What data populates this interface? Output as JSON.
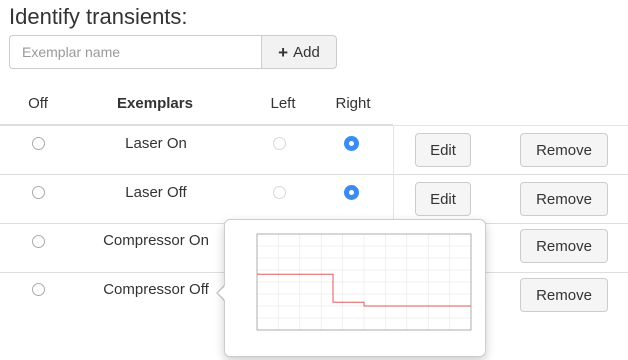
{
  "title": "Identify transients:",
  "exemplar_input": {
    "placeholder": "Exemplar name",
    "value": ""
  },
  "add_button": {
    "label": "Add",
    "icon": "plus-icon"
  },
  "table": {
    "headers": {
      "off": "Off",
      "exemplars": "Exemplars",
      "left": "Left",
      "right": "Right"
    },
    "rows": [
      {
        "name": "Laser On",
        "selected": "right",
        "edit_label": "Edit",
        "remove_label": "Remove"
      },
      {
        "name": "Laser Off",
        "selected": "right",
        "edit_label": "Edit",
        "remove_label": "Remove"
      },
      {
        "name": "Compressor On",
        "selected": "off",
        "remove_label": "Remove"
      },
      {
        "name": "Compressor Off",
        "selected": "off",
        "remove_label": "Remove"
      }
    ]
  },
  "colors": {
    "radio_checked": "#3a8cf0",
    "chart_line": "#e05a5a"
  },
  "chart_data": {
    "type": "line",
    "series": [
      {
        "x": [
          0,
          0.355,
          0.355,
          0.5,
          0.5,
          1.0
        ],
        "y": [
          0.42,
          0.42,
          0.71,
          0.71,
          0.75,
          0.75
        ]
      }
    ],
    "ylim": [
      0,
      1
    ],
    "xlim": [
      0,
      1
    ],
    "grid": true
  }
}
